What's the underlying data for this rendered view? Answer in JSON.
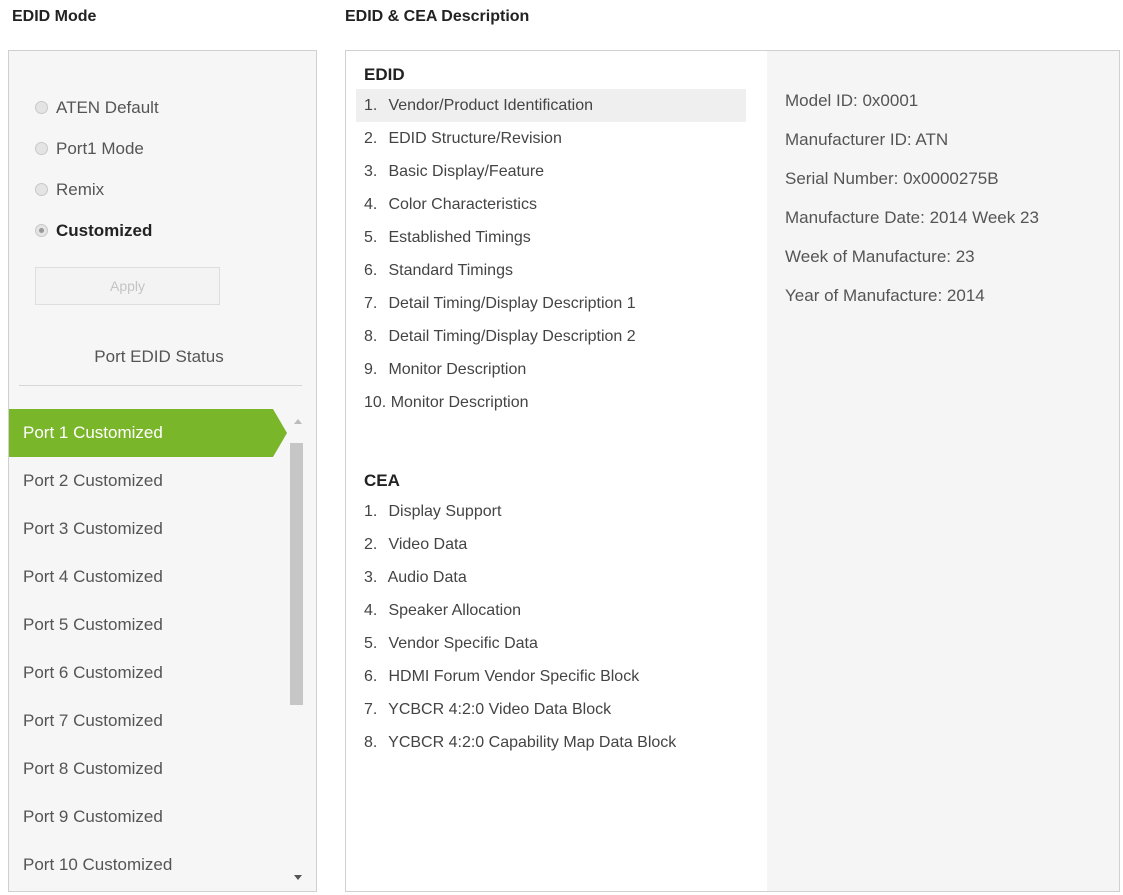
{
  "headings": {
    "edid_mode": "EDID Mode",
    "description": "EDID & CEA Description"
  },
  "modes": [
    {
      "label": "ATEN Default",
      "checked": false
    },
    {
      "label": "Port1 Mode",
      "checked": false
    },
    {
      "label": "Remix",
      "checked": false
    },
    {
      "label": "Customized",
      "checked": true
    }
  ],
  "apply_label": "Apply",
  "status_title": "Port EDID Status",
  "ports": [
    {
      "label": "Port 1  Customized",
      "active": true
    },
    {
      "label": "Port 2  Customized",
      "active": false
    },
    {
      "label": "Port 3  Customized",
      "active": false
    },
    {
      "label": "Port 4  Customized",
      "active": false
    },
    {
      "label": "Port 5  Customized",
      "active": false
    },
    {
      "label": "Port 6  Customized",
      "active": false
    },
    {
      "label": "Port 7  Customized",
      "active": false
    },
    {
      "label": "Port 8  Customized",
      "active": false
    },
    {
      "label": "Port 9  Customized",
      "active": false
    },
    {
      "label": "Port 10  Customized",
      "active": false
    }
  ],
  "edid": {
    "title": "EDID",
    "items": [
      {
        "num": "1.",
        "label": "Vendor/Product Identification"
      },
      {
        "num": "2.",
        "label": "EDID Structure/Revision"
      },
      {
        "num": "3.",
        "label": "Basic Display/Feature"
      },
      {
        "num": "4.",
        "label": "Color Characteristics"
      },
      {
        "num": "5.",
        "label": "Established Timings"
      },
      {
        "num": "6.",
        "label": "Standard Timings"
      },
      {
        "num": "7.",
        "label": "Detail Timing/Display Description 1"
      },
      {
        "num": "8.",
        "label": "Detail Timing/Display Description 2"
      },
      {
        "num": "9.",
        "label": "Monitor Description"
      },
      {
        "num": "10.",
        "label": "Monitor Description"
      }
    ]
  },
  "cea": {
    "title": "CEA",
    "items": [
      {
        "num": "1.",
        "label": "Display Support"
      },
      {
        "num": "2.",
        "label": "Video Data"
      },
      {
        "num": "3.",
        "label": "Audio Data"
      },
      {
        "num": "4.",
        "label": "Speaker Allocation"
      },
      {
        "num": "5.",
        "label": "Vendor Specific Data"
      },
      {
        "num": "6.",
        "label": "HDMI Forum Vendor Specific Block"
      },
      {
        "num": "7.",
        "label": "YCBCR 4:2:0 Video Data Block"
      },
      {
        "num": "8.",
        "label": "YCBCR 4:2:0 Capability Map Data Block"
      }
    ]
  },
  "details": [
    "Model ID: 0x0001",
    "Manufacturer ID: ATN",
    "Serial Number: 0x0000275B",
    "Manufacture Date: 2014 Week 23",
    "Week of Manufacture: 23",
    "Year of Manufacture: 2014"
  ],
  "colors": {
    "active_port": "#7ab62a",
    "panel_bg": "#f6f6f6"
  }
}
